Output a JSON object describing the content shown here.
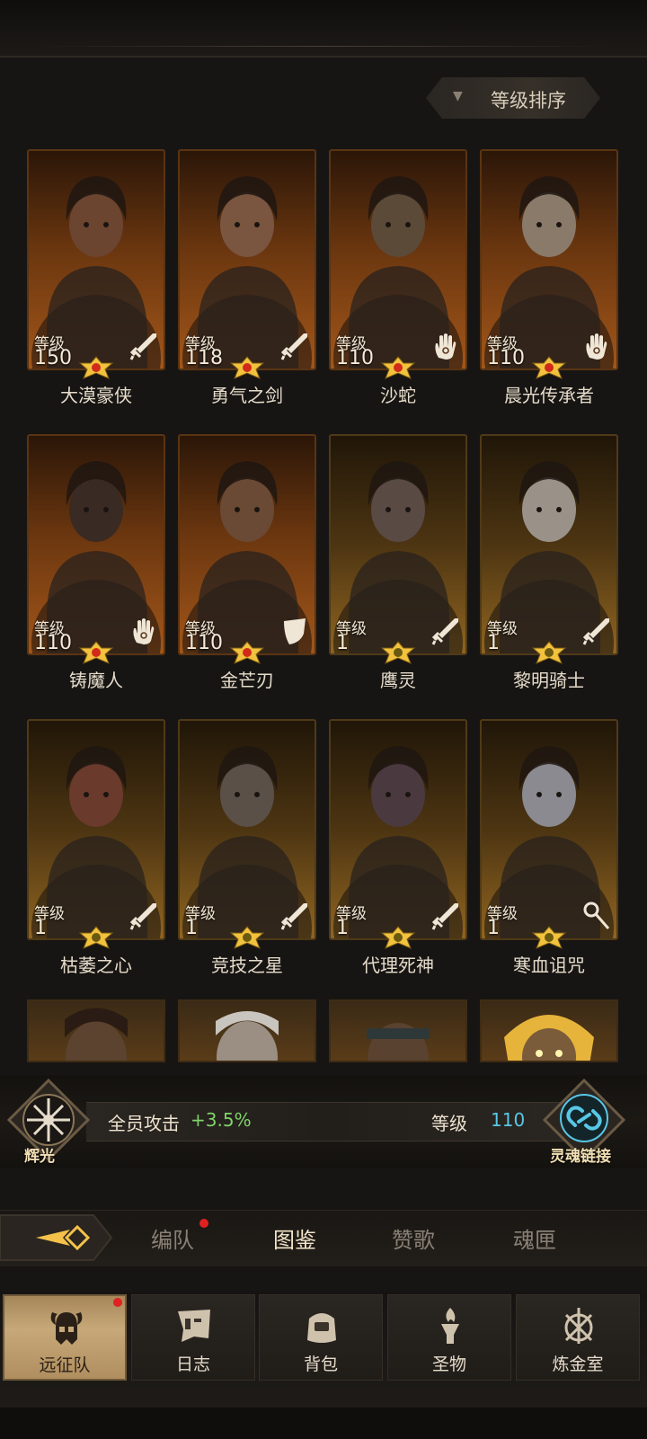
{
  "sort": {
    "label": "等级排序"
  },
  "level_label": "等级",
  "heroes": [
    {
      "name": "大漠豪侠",
      "level": "150",
      "class_icon": "sword-icon",
      "frame": "orange"
    },
    {
      "name": "勇气之剑",
      "level": "118",
      "class_icon": "sword-icon",
      "frame": "orange"
    },
    {
      "name": "沙蛇",
      "level": "110",
      "class_icon": "palm-icon",
      "frame": "orange"
    },
    {
      "name": "晨光传承者",
      "level": "110",
      "class_icon": "palm-icon",
      "frame": "orange"
    },
    {
      "name": "铸魔人",
      "level": "110",
      "class_icon": "palm-icon",
      "frame": "orange"
    },
    {
      "name": "金芒刃",
      "level": "110",
      "class_icon": "shield-icon",
      "frame": "orange"
    },
    {
      "name": "鹰灵",
      "level": "1",
      "class_icon": "sword-icon",
      "frame": "gold"
    },
    {
      "name": "黎明骑士",
      "level": "1",
      "class_icon": "sword-icon",
      "frame": "gold"
    },
    {
      "name": "枯萎之心",
      "level": "1",
      "class_icon": "sword-icon",
      "frame": "gold"
    },
    {
      "name": "竞技之星",
      "level": "1",
      "class_icon": "sword-icon",
      "frame": "gold"
    },
    {
      "name": "代理死神",
      "level": "1",
      "class_icon": "sword-icon",
      "frame": "gold"
    },
    {
      "name": "寒血诅咒",
      "level": "1",
      "class_icon": "staff-icon",
      "frame": "gold"
    }
  ],
  "bonus": {
    "left_emblem_label": "辉光",
    "text": "全员攻击",
    "value": "+3.5%",
    "level_text": "等级",
    "level_value": "110",
    "right_emblem_label": "灵魂链接"
  },
  "tabs": [
    {
      "label": "编队",
      "active": false,
      "badge": true
    },
    {
      "label": "图鉴",
      "active": true,
      "badge": false
    },
    {
      "label": "赞歌",
      "active": false,
      "badge": false
    },
    {
      "label": "魂匣",
      "active": false,
      "badge": false
    }
  ],
  "nav": [
    {
      "label": "远征队",
      "icon": "helmet-icon",
      "active": true,
      "badge": true
    },
    {
      "label": "日志",
      "icon": "scroll-icon",
      "active": false,
      "badge": false
    },
    {
      "label": "背包",
      "icon": "bag-icon",
      "active": false,
      "badge": false
    },
    {
      "label": "圣物",
      "icon": "torch-icon",
      "active": false,
      "badge": false
    },
    {
      "label": "炼金室",
      "icon": "flask-icon",
      "active": false,
      "badge": false
    }
  ],
  "colors": {
    "accent_green": "#7fd36a",
    "accent_cyan": "#58c7e6",
    "badge_red": "#e12121"
  }
}
